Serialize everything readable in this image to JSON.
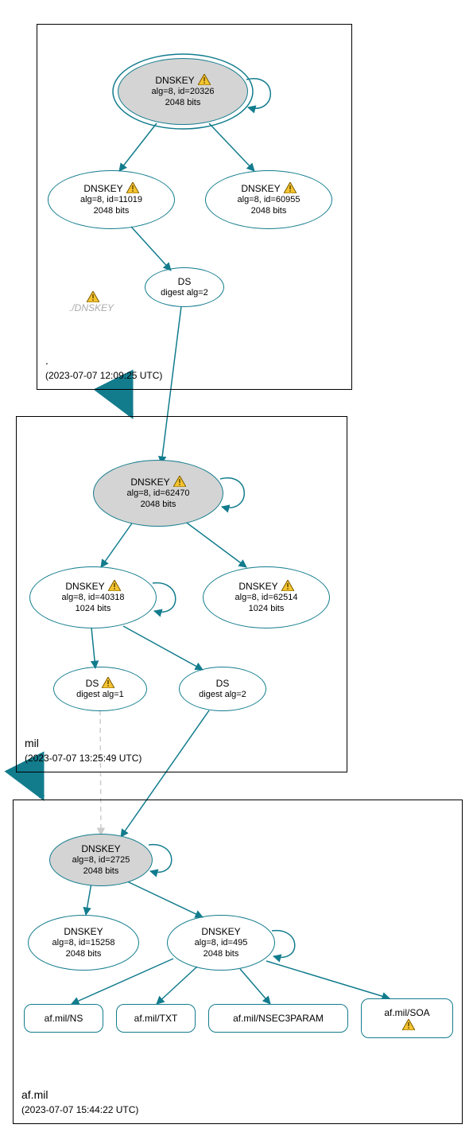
{
  "zones": {
    "root": {
      "name": ".",
      "timestamp": "(2023-07-07 12:09:25 UTC)"
    },
    "mil": {
      "name": "mil",
      "timestamp": "(2023-07-07 13:25:49 UTC)"
    },
    "af": {
      "name": "af.mil",
      "timestamp": "(2023-07-07 15:44:22 UTC)"
    }
  },
  "nodes": {
    "root_ksk": {
      "label": "DNSKEY",
      "l2": "alg=8, id=20326",
      "l3": "2048 bits",
      "warn": true
    },
    "root_zsk1": {
      "label": "DNSKEY",
      "l2": "alg=8, id=11019",
      "l3": "2048 bits",
      "warn": true
    },
    "root_zsk2": {
      "label": "DNSKEY",
      "l2": "alg=8, id=60955",
      "l3": "2048 bits",
      "warn": true
    },
    "root_ds": {
      "label": "DS",
      "l2": "digest alg=2"
    },
    "root_skip": {
      "label": "./DNSKEY",
      "warn": true
    },
    "mil_ksk": {
      "label": "DNSKEY",
      "l2": "alg=8, id=62470",
      "l3": "2048 bits",
      "warn": true
    },
    "mil_zsk1": {
      "label": "DNSKEY",
      "l2": "alg=8, id=40318",
      "l3": "1024 bits",
      "warn": true
    },
    "mil_zsk2": {
      "label": "DNSKEY",
      "l2": "alg=8, id=62514",
      "l3": "1024 bits",
      "warn": true
    },
    "mil_ds1": {
      "label": "DS",
      "l2": "digest alg=1",
      "warn": true
    },
    "mil_ds2": {
      "label": "DS",
      "l2": "digest alg=2"
    },
    "af_ksk": {
      "label": "DNSKEY",
      "l2": "alg=8, id=2725",
      "l3": "2048 bits"
    },
    "af_zsk1": {
      "label": "DNSKEY",
      "l2": "alg=8, id=15258",
      "l3": "2048 bits"
    },
    "af_zsk2": {
      "label": "DNSKEY",
      "l2": "alg=8, id=495",
      "l3": "2048 bits"
    },
    "af_ns": {
      "label": "af.mil/NS"
    },
    "af_txt": {
      "label": "af.mil/TXT"
    },
    "af_n3p": {
      "label": "af.mil/NSEC3PARAM"
    },
    "af_soa": {
      "label": "af.mil/SOA",
      "warn": true
    }
  }
}
